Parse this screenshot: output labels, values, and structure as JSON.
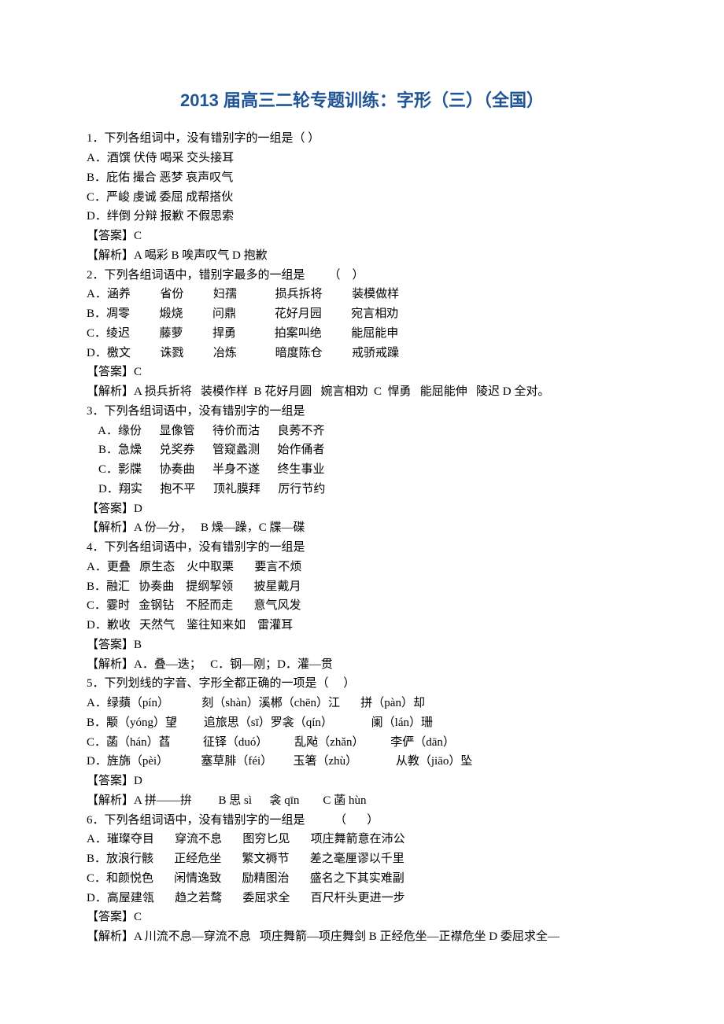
{
  "title": "2013 届高三二轮专题训练：字形（三）（全国）",
  "q1": {
    "stem": "1．下列各组词中，没有错别字的一组是（ ）",
    "a": "A．酒馔 伏侍 喝采 交头接耳",
    "b": "B．庇佑 撮合 恶梦 哀声叹气",
    "c": "C．严峻 虔诚 委屈 成帮搭伙",
    "d": "D．绊倒 分辩 报歉 不假思索",
    "ans": "【答案】C",
    "exp": "【解析】A 喝彩 B 唉声叹气 D 抱歉"
  },
  "q2": {
    "stem": "2．下列各组词语中，错别字最多的一组是        （    ）",
    "a": "A．涵养          省份          妇孺             损兵拆将          装模做样",
    "b": "B．凋零          煅烧          问鼎             花好月园          宛言相劝",
    "c": "C．绫迟          藤萝          捍勇             拍案叫绝          能屈能申",
    "d": "D．檄文          诛戮          冶炼             暗度陈仓          戒骄戒躁",
    "ans": "【答案】C",
    "exp": "【解析】A 损兵折将   装模作样  B 花好月圆   婉言相劝  C  悍勇   能屈能伸   陵迟 D 全对。"
  },
  "q3": {
    "stem": "3．下列各组词语中，没有错别字的一组是",
    "a": "    A．缘份      显像管      待价而沽      良莠不齐",
    "b": "    B．急燥      兑奖券      管窥蠡测      始作俑者",
    "c": "    C．影牒      协奏曲      半身不遂      终生事业",
    "d": "    D．翔实      抱不平      顶礼膜拜      厉行节约",
    "ans": "【答案】D",
    "exp": "【解析】A 份—分，   B 燥—躁，C 牒—碟"
  },
  "q4": {
    "stem": "4．下列各组词语中，没有错别字的一组是",
    "a": "A．更叠   原生态    火中取栗       要言不烦",
    "b": "B．融汇   协奏曲    提纲挈领       披星戴月",
    "c": "C．霎时   金钢钻    不胫而走       意气风发",
    "d": "D．歉收   天然气    鉴往知来如    雷灌耳",
    "ans": "【答案】B",
    "exp": "【解析】A．叠—迭；   C．钢—刚；D．灌—贯"
  },
  "q5": {
    "stem": "5．下列划线的字音、字形全都正确的一项是（     ）",
    "a": "A．绿蘋（pín）           刻（shàn）溪郴（chēn）江       拼（pàn）却",
    "b": "B．颙（yóng）望         追旅思（sī）罗衾（qín）             阑（lán）珊",
    "c": "C．菡（hán）萏           征铎（duó）         乱飐（zhǎn）         李俨（dān）",
    "d": "D．旌旆（pèi）           塞草腓（féi）       玉箸（zhù）             从教（jiāo）坠",
    "ans": "【答案】D",
    "exp": "【解析】A 拼——拚         B 思 sì      衾 qīn        C 菡 hùn"
  },
  "q6": {
    "stem": "6．下列各组词语中，没有错别字的一组是          （       ）",
    "a": "A．璀璨夺目       穿流不息       图穷匕见       项庄舞箭意在沛公",
    "b": "B．放浪行骸       正经危坐       繁文褥节       差之毫厘谬以千里",
    "c": "C．和颜悦色       闲情逸致       励精图治       盛名之下其实难副",
    "d": "D．高屋建瓴       趋之若鹜       委屈求全       百尺杆头更进一步",
    "ans": "【答案】C",
    "exp": "【解析】A 川流不息—穿流不息   项庄舞箭—项庄舞剑 B 正经危坐—正襟危坐 D 委屈求全—"
  }
}
